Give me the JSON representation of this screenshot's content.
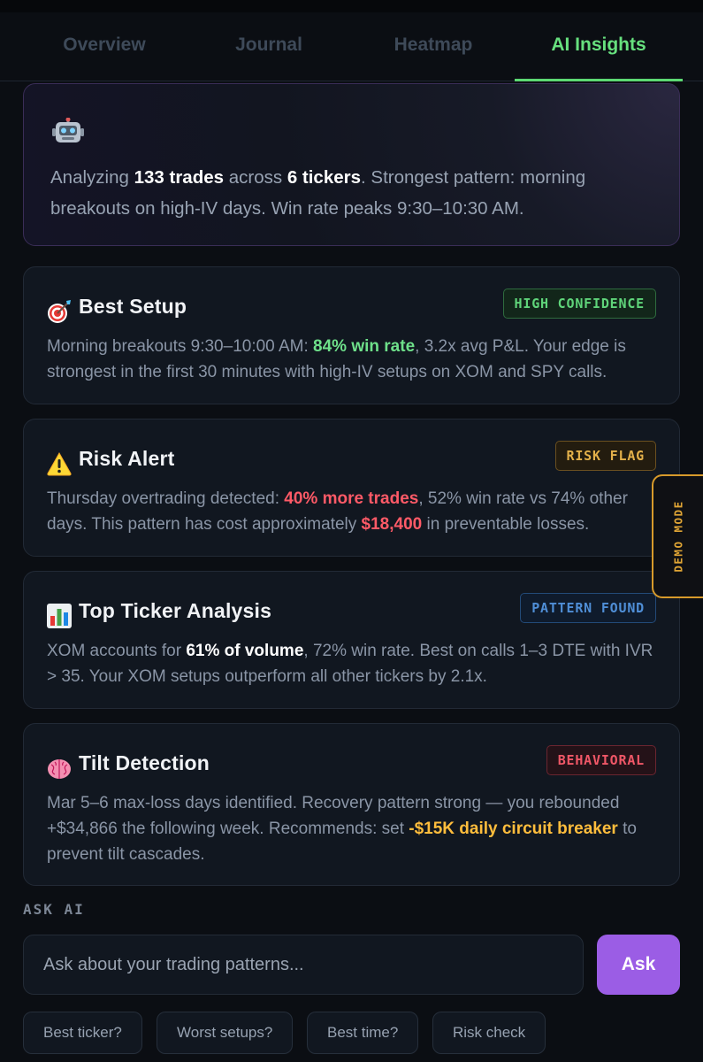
{
  "tabs": [
    {
      "label": "Overview"
    },
    {
      "label": "Journal"
    },
    {
      "label": "Heatmap"
    },
    {
      "label": "AI Insights",
      "active": true
    }
  ],
  "summary": {
    "icon": "robot-icon",
    "pre": "Analyzing ",
    "trades": "133 trades",
    "mid": " across ",
    "tickers": "6 tickers",
    "post": ". Strongest pattern: morning breakouts on high-IV days. Win rate peaks 9:30–10:30 AM."
  },
  "cards": [
    {
      "icon": "target-icon",
      "title": "Best Setup",
      "badge": "HIGH CONFIDENCE",
      "body": [
        "Morning breakouts 9:30–10:00 AM: ",
        "84% win rate",
        ", 3.2x avg P&L. Your edge is strongest in the first 30 minutes with high-IV setups on XOM and SPY calls."
      ]
    },
    {
      "icon": "warning-icon",
      "title": "Risk Alert",
      "badge": "RISK FLAG",
      "body": [
        "Thursday overtrading detected: ",
        "40% more trades",
        ", 52% win rate vs 74% other days. This pattern has cost approximately ",
        "$18,400",
        " in preventable losses."
      ]
    },
    {
      "icon": "bar-chart-icon",
      "title": "Top Ticker Analysis",
      "badge": "PATTERN FOUND",
      "body": [
        "XOM accounts for ",
        "61% of volume",
        ", 72% win rate. Best on calls 1–3 DTE with IVR > 35. Your XOM setups outperform all other tickers by 2.1x."
      ]
    },
    {
      "icon": "brain-icon",
      "title": "Tilt Detection",
      "badge": "BEHAVIORAL",
      "body": [
        "Mar 5–6 max-loss days identified. Recovery pattern strong — you rebounded +$34,866 the following week. Recommends: set ",
        "-$15K daily circuit breaker",
        " to prevent tilt cascades."
      ]
    }
  ],
  "demo_tab": "DEMO MODE",
  "ask": {
    "label": "ASK AI",
    "placeholder": "Ask about your trading patterns...",
    "button": "Ask",
    "chips": [
      "Best ticker?",
      "Worst setups?",
      "Best time?",
      "Risk check"
    ]
  },
  "colors": {
    "accent_green": "#67e07e",
    "accent_purple": "#9b5de5",
    "alert_red": "#ff5a67",
    "alert_amber": "#ffbd3c",
    "demo_amber": "#e0a535"
  }
}
